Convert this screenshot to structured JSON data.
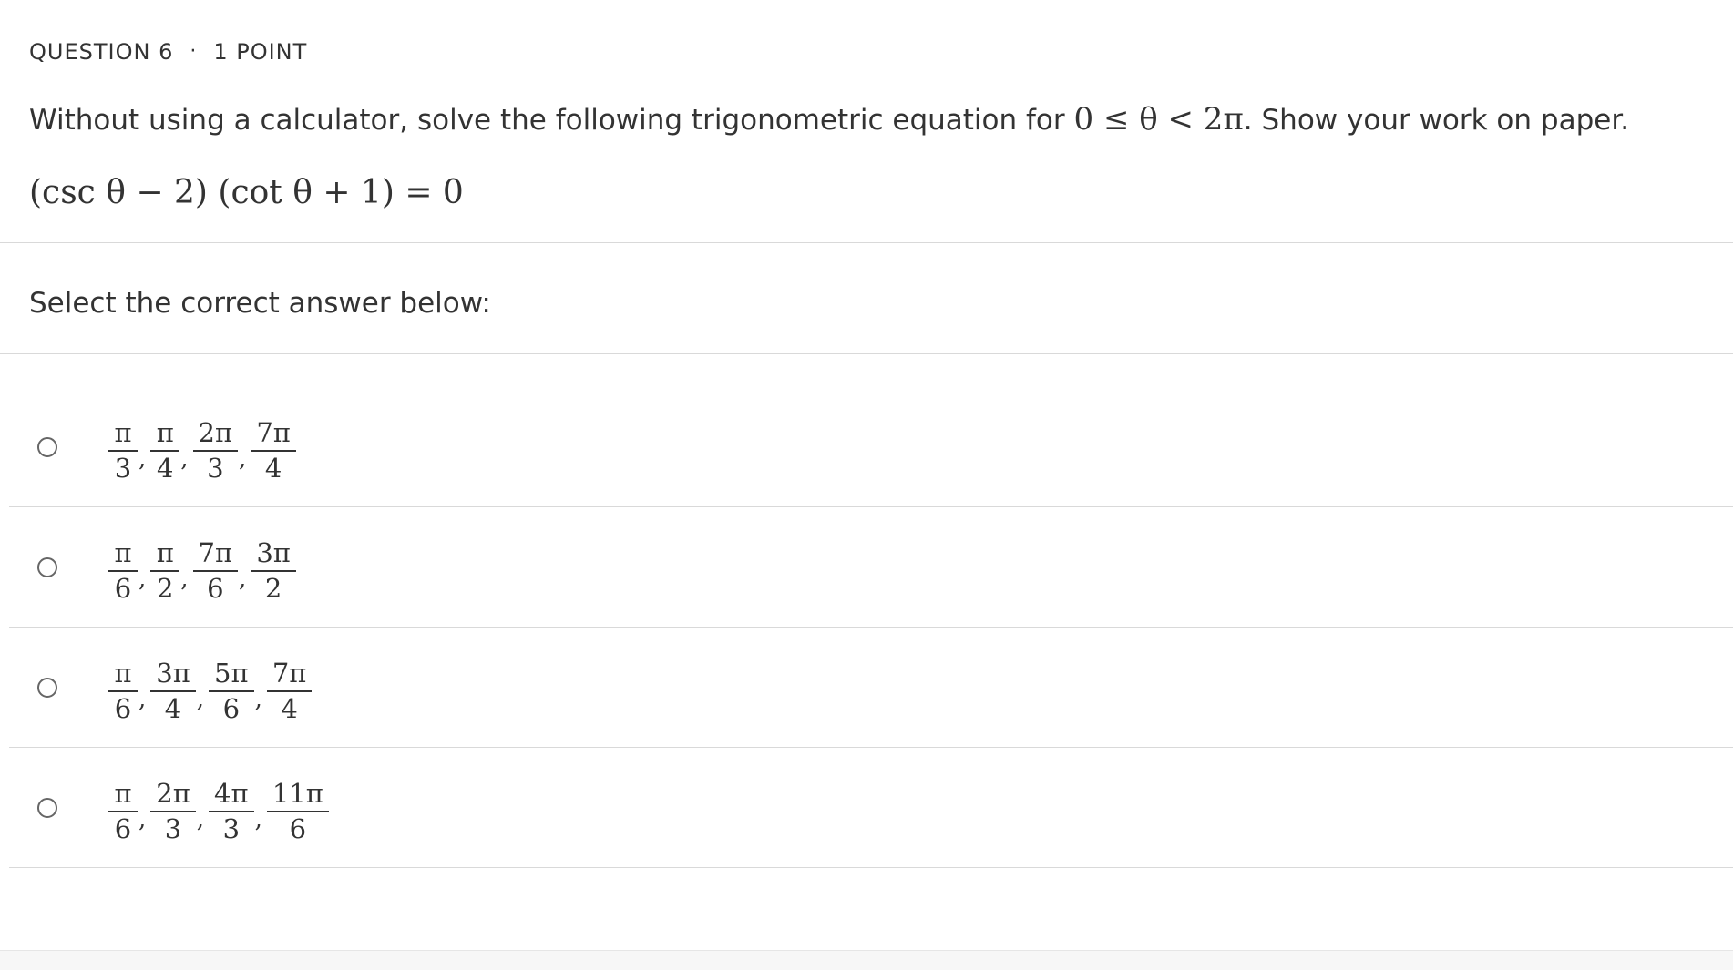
{
  "question": {
    "number_label": "QUESTION 6",
    "separator": "·",
    "points_label": "1 POINT",
    "prompt_before": "Without using a calculator, solve the following trigonometric equation for ",
    "prompt_condition": "0 ≤ θ < 2π",
    "prompt_after": ". Show your work on paper.",
    "equation": "(csc θ − 2) (cot θ + 1) = 0"
  },
  "answer_section": {
    "select_label": "Select the correct answer below:"
  },
  "options": [
    {
      "fractions": [
        {
          "num": "π",
          "den": "3"
        },
        {
          "num": "π",
          "den": "4"
        },
        {
          "num": "2π",
          "den": "3"
        },
        {
          "num": "7π",
          "den": "4"
        }
      ]
    },
    {
      "fractions": [
        {
          "num": "π",
          "den": "6"
        },
        {
          "num": "π",
          "den": "2"
        },
        {
          "num": "7π",
          "den": "6"
        },
        {
          "num": "3π",
          "den": "2"
        }
      ]
    },
    {
      "fractions": [
        {
          "num": "π",
          "den": "6"
        },
        {
          "num": "3π",
          "den": "4"
        },
        {
          "num": "5π",
          "den": "6"
        },
        {
          "num": "7π",
          "den": "4"
        }
      ]
    },
    {
      "fractions": [
        {
          "num": "π",
          "den": "6"
        },
        {
          "num": "2π",
          "den": "3"
        },
        {
          "num": "4π",
          "den": "3"
        },
        {
          "num": "11π",
          "den": "6"
        }
      ]
    }
  ],
  "colors": {
    "text": "#333333",
    "divider": "#d9d9d9",
    "radio_border": "#666666"
  }
}
